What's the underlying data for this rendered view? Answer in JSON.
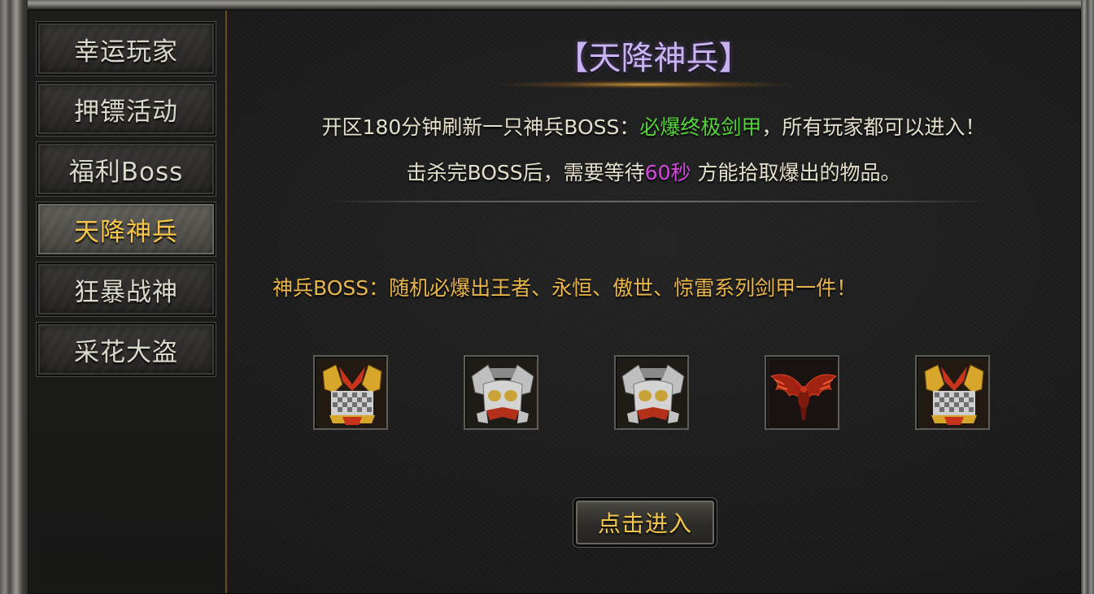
{
  "sidebar": {
    "items": [
      {
        "label": "幸运玩家"
      },
      {
        "label": "押镖活动"
      },
      {
        "label": "福利Boss"
      },
      {
        "label": "天降神兵"
      },
      {
        "label": "狂暴战神"
      },
      {
        "label": "采花大盗"
      }
    ],
    "active_index": 3
  },
  "panel": {
    "title": "【天降神兵】",
    "line1_pre": "开区180分钟刷新一只神兵BOSS：",
    "line1_highlight": "必爆终极剑甲",
    "line1_post": "，所有玩家都可以进入！",
    "line2_pre": "击杀完BOSS后，需要等待",
    "line2_highlight": "60秒",
    "line2_post": "方能拾取爆出的物品。",
    "drop_text": "神兵BOSS：随机必爆出王者、永恒、傲世、惊雷系列剑甲一件！",
    "items": [
      {
        "icon": "gold-armor-icon"
      },
      {
        "icon": "silver-armor-icon"
      },
      {
        "icon": "silver-armor-icon"
      },
      {
        "icon": "demon-wing-armor-icon"
      },
      {
        "icon": "gold-armor-icon"
      }
    ],
    "enter_label": "点击进入"
  },
  "colors": {
    "title": "#c9b3f0",
    "highlight_green": "#56d33c",
    "highlight_purple": "#d248e0",
    "drop_text": "#eab54a",
    "active_label": "#f5c64a"
  }
}
